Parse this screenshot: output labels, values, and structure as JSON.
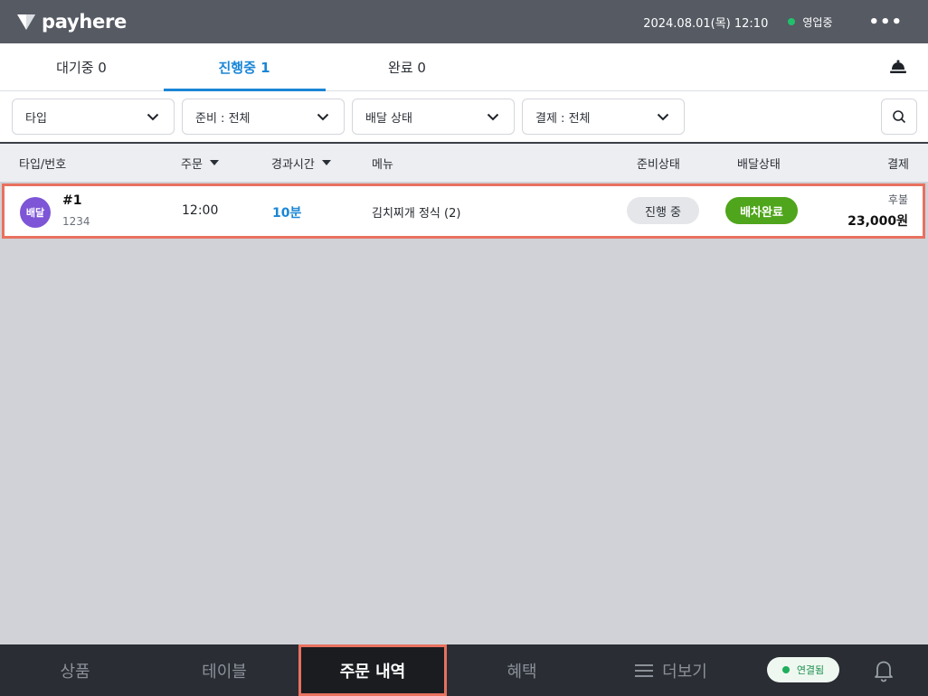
{
  "topbar": {
    "brand": "payhere",
    "datetime": "2024.08.01(목) 12:10",
    "store_status": "영업중",
    "more_label": "•••"
  },
  "tabs": [
    {
      "label": "대기중 0",
      "active": false
    },
    {
      "label": "진행중 1",
      "active": true
    },
    {
      "label": "완료 0",
      "active": false
    }
  ],
  "filters": [
    {
      "label": "타입"
    },
    {
      "label": "준비 : 전체"
    },
    {
      "label": "배달 상태"
    },
    {
      "label": "결제 : 전체"
    }
  ],
  "table": {
    "headers": {
      "type_no": "타입/번호",
      "order": "주문",
      "elapsed": "경과시간",
      "menu": "메뉴",
      "prep_status": "준비상태",
      "delivery_status": "배달상태",
      "payment": "결제"
    },
    "rows": [
      {
        "type": "배달",
        "number": "#1",
        "sub": "1234",
        "order_time": "12:00",
        "elapsed": "10분",
        "menu": "김치찌개 정식 (2)",
        "prep_status": "진행 중",
        "delivery_status": "배차완료",
        "payment_method": "후불",
        "payment_amount": "23,000원"
      }
    ]
  },
  "bottom_nav": {
    "items": [
      {
        "label": "상품",
        "active": false
      },
      {
        "label": "테이블",
        "active": false
      },
      {
        "label": "주문 내역",
        "active": true
      },
      {
        "label": "혜택",
        "active": false
      },
      {
        "label": "더보기",
        "active": false
      }
    ],
    "connection": "연결됨"
  },
  "colors": {
    "accent_blue": "#1a86d6",
    "highlight": "#e8715f",
    "delivery_badge": "#7d55d6",
    "dispatched_green": "#4fa51b",
    "status_green": "#22c06b"
  },
  "icons": [
    "logo-icon",
    "more-icon",
    "bell-icon",
    "chevron-down-icon",
    "search-icon",
    "menu-icon"
  ]
}
